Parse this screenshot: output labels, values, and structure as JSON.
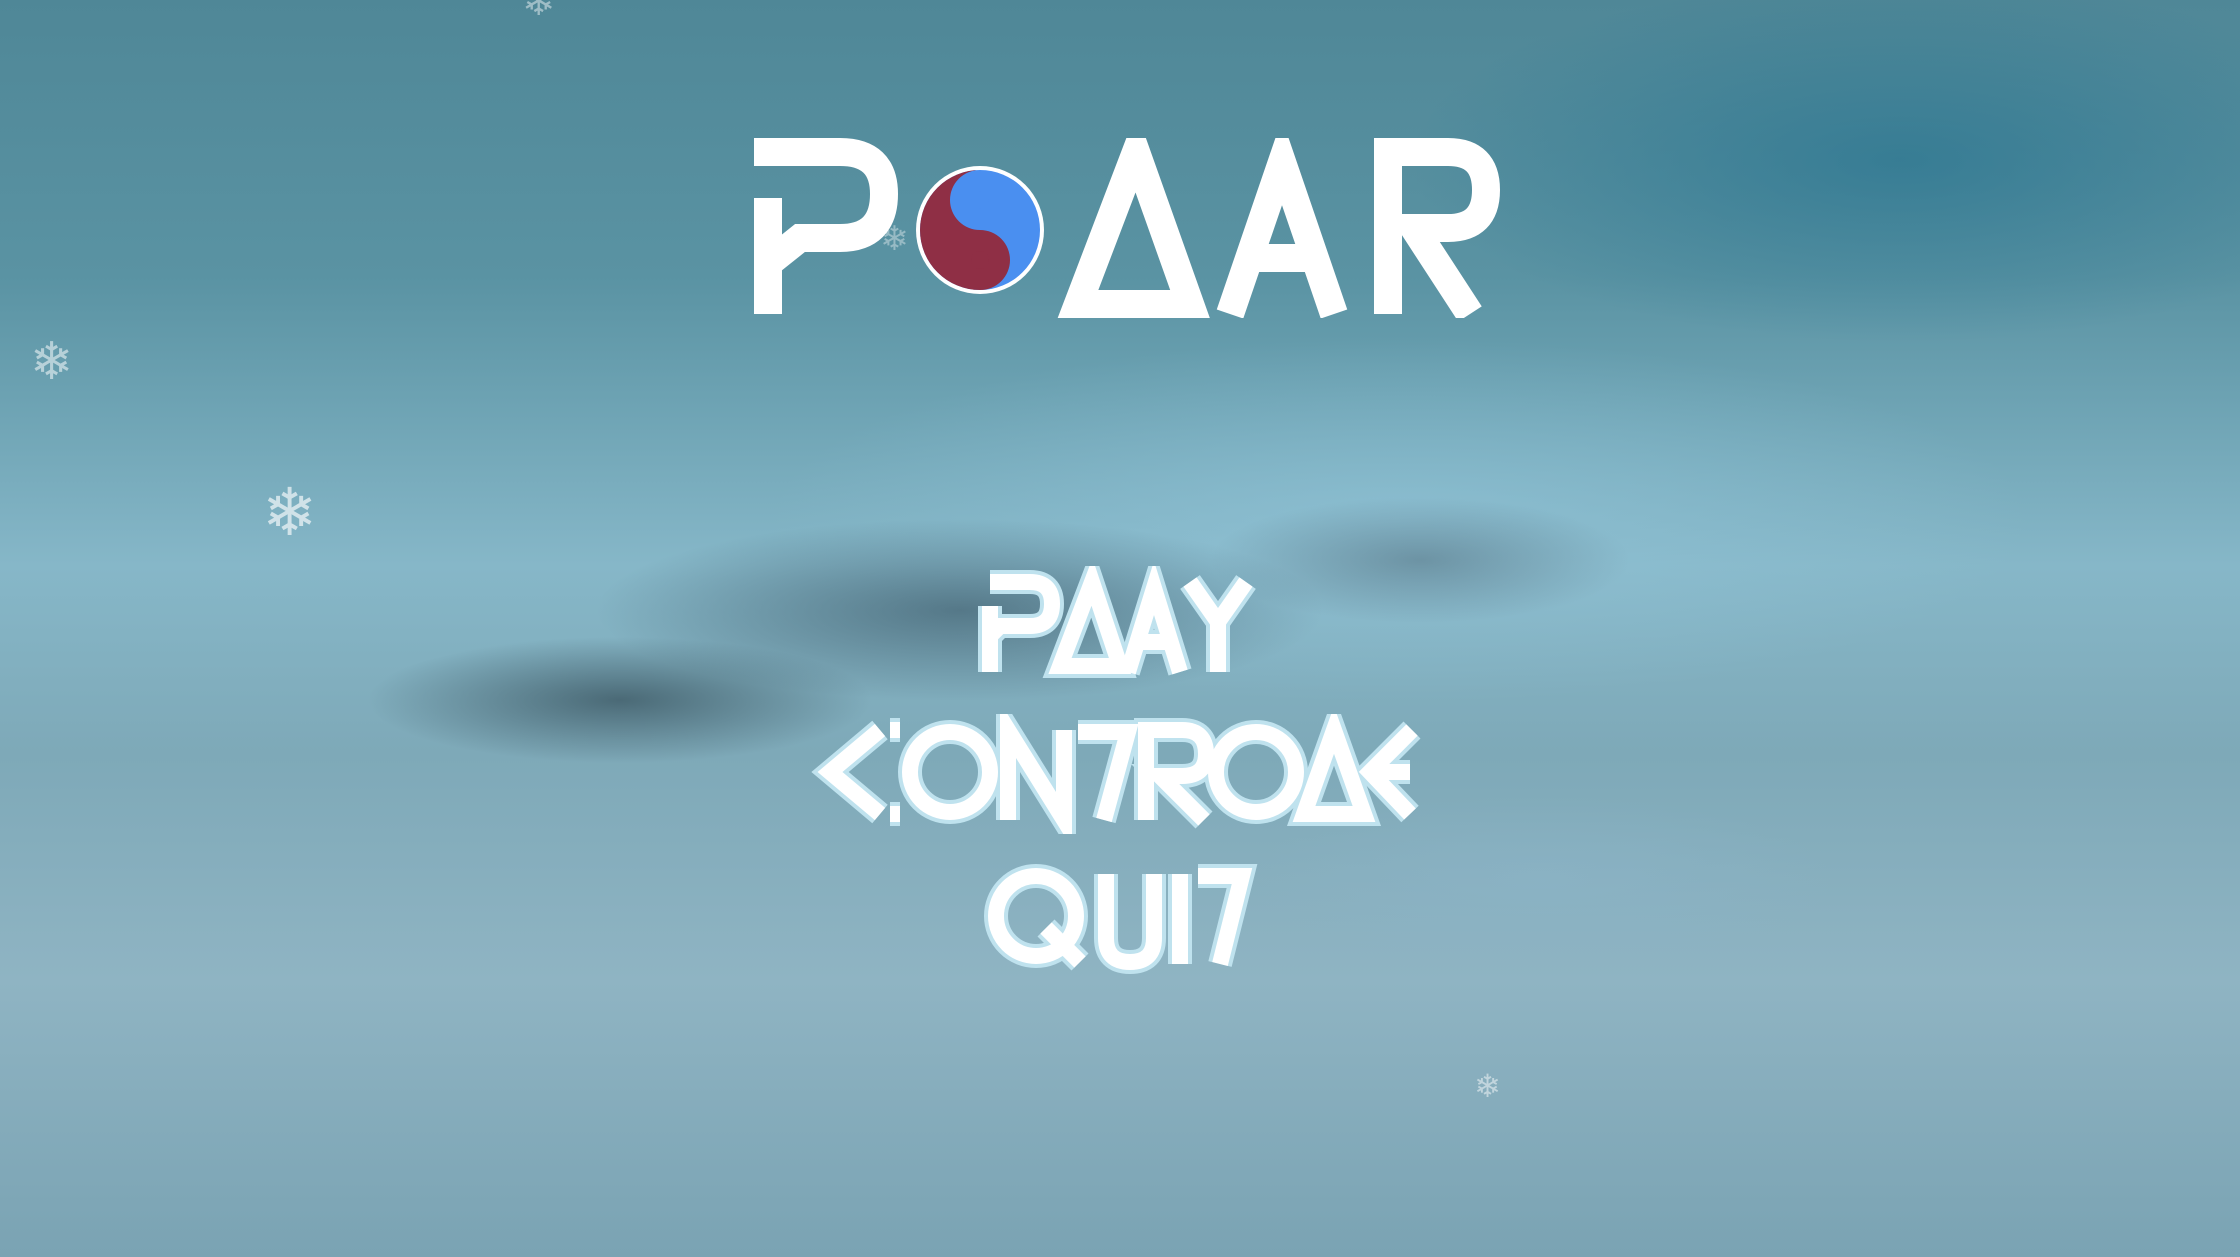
{
  "game": {
    "title": "POLAR"
  },
  "menu": {
    "items": [
      {
        "label": "PLAY"
      },
      {
        "label": "CONTROLS"
      },
      {
        "label": "QUIT"
      }
    ]
  },
  "decor": {
    "snowflake_glyph": "❄",
    "yin_yang_colors": {
      "light": "#4a8ff0",
      "dark": "#8f2f45"
    },
    "text_color": "#ffffff",
    "outline_color": "#bfe2ee"
  }
}
